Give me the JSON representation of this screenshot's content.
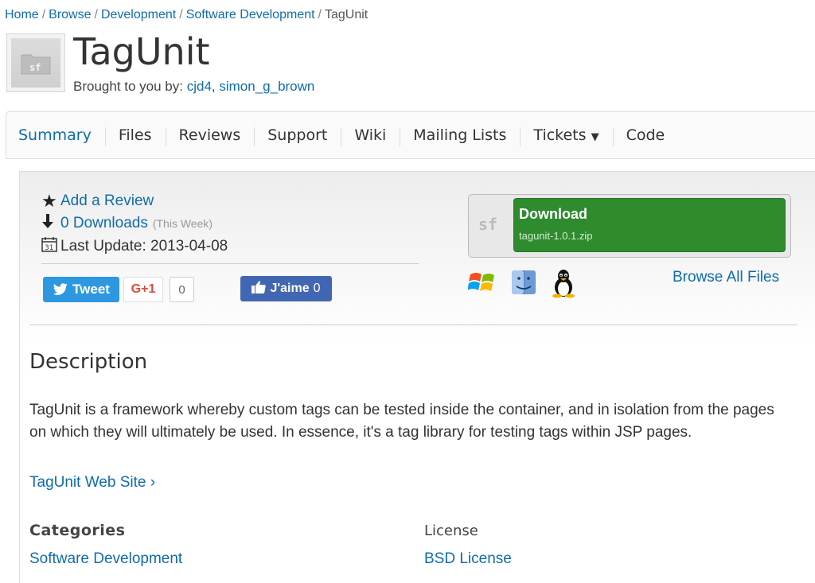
{
  "breadcrumb": {
    "items": [
      "Home",
      "Browse",
      "Development",
      "Software Development"
    ],
    "current": "TagUnit"
  },
  "project": {
    "icon": "sf-folder-icon",
    "title": "TagUnit",
    "brought_label": "Brought to you by:",
    "authors": [
      "cjd4",
      "simon_g_brown"
    ]
  },
  "tabs": [
    "Summary",
    "Files",
    "Reviews",
    "Support",
    "Wiki",
    "Mailing Lists",
    "Tickets",
    "Code"
  ],
  "stats": {
    "add_review": "Add a Review",
    "downloads": "0 Downloads",
    "downloads_period": "(This Week)",
    "last_update": "Last Update: 2013-04-08"
  },
  "social": {
    "tweet": "Tweet",
    "gplus": "G+1",
    "gplus_count": "0",
    "fb_like": "J'aime",
    "fb_count": "0"
  },
  "download": {
    "sf_logo": "sf",
    "title": "Download",
    "file": "tagunit-1.0.1.zip",
    "os_icons": [
      "windows-icon",
      "mac-icon",
      "linux-icon"
    ],
    "browse_all": "Browse All Files"
  },
  "description": {
    "heading": "Description",
    "text": "TagUnit is a framework whereby custom tags can be tested inside the container, and in isolation from the pages on which they will ultimately be used. In essence, it's a tag library for testing tags within JSP pages.",
    "website": "TagUnit Web Site ›"
  },
  "meta": {
    "categories_heading": "Categories",
    "categories_value": "Software Development",
    "license_heading": "License",
    "license_value": "BSD License"
  },
  "colors": {
    "link": "#0f6cad",
    "download_green": "#2e8b2e",
    "twitter": "#2d98df",
    "facebook": "#4267b2",
    "gplus": "#dd4b39"
  }
}
